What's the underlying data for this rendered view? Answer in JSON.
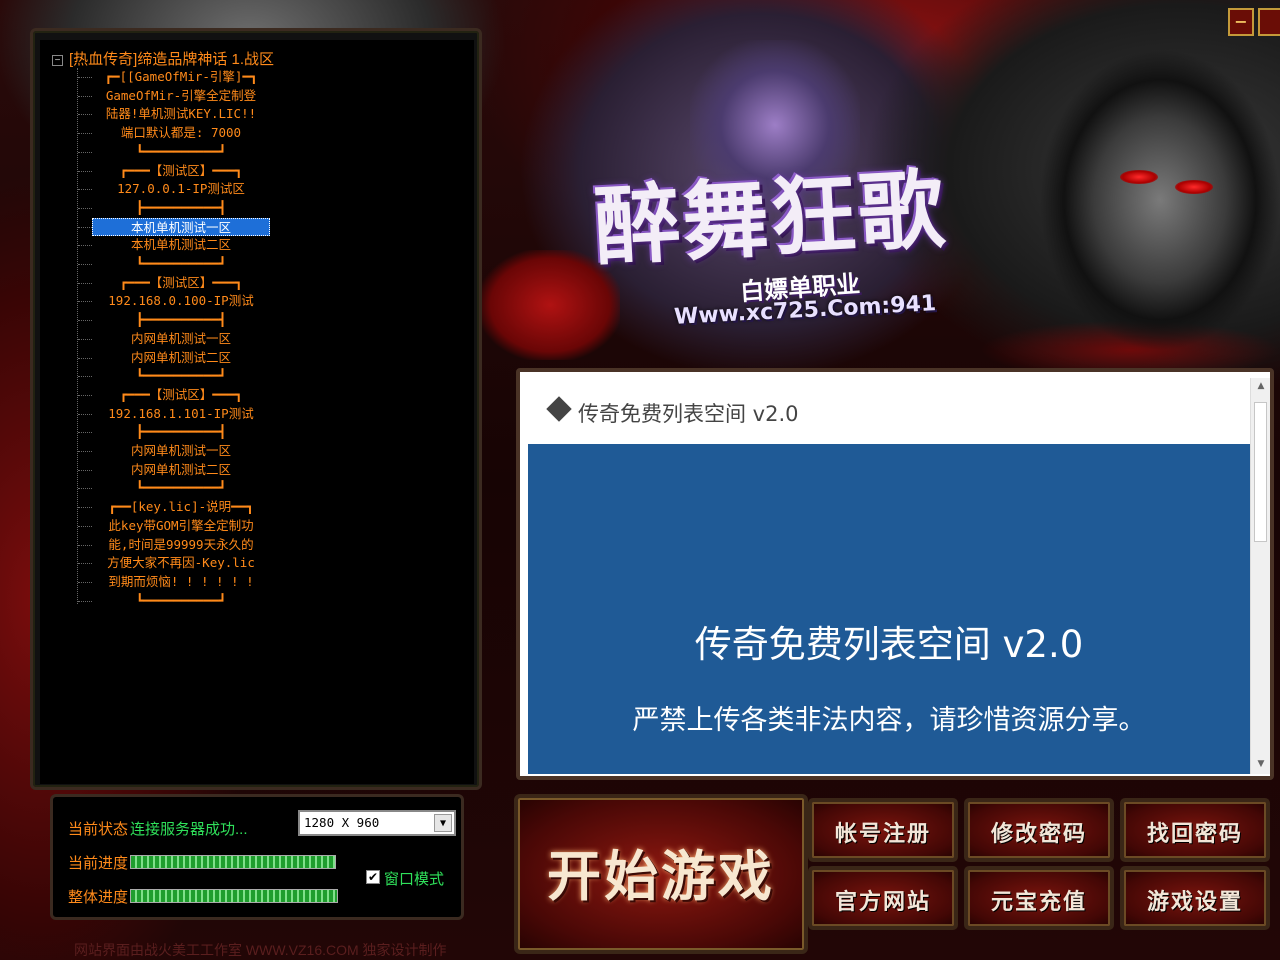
{
  "window": {
    "minimize_label": "−"
  },
  "logo": {
    "title": "醉舞狂歌",
    "subtitle": "白嫖单职业",
    "url": "Www.xc725.Com:941"
  },
  "tree": {
    "root_label": "[热血传奇]缔造品牌神话 1.战区",
    "items": [
      {
        "label": "┏━[[GameOfMir-引擎]━┓"
      },
      {
        "label": "GameOfMir-引擎全定制登"
      },
      {
        "label": "陆器!单机测试KEY.LIC!!"
      },
      {
        "label": "端口默认都是: 7000"
      },
      {
        "label": "┗━━━━━━━━━━┛"
      },
      {
        "label": "┏━━━【测试区】━━━┓"
      },
      {
        "label": "127.0.0.1-IP测试区"
      },
      {
        "label": "┣━━━━━━━━━━┫"
      },
      {
        "label": "本机单机测试一区"
      },
      {
        "label": "本机单机测试二区"
      },
      {
        "label": "┗━━━━━━━━━━┛"
      },
      {
        "label": "┏━━━【测试区】━━━┓"
      },
      {
        "label": "192.168.0.100-IP测试"
      },
      {
        "label": "┣━━━━━━━━━━┫"
      },
      {
        "label": "内网单机测试一区"
      },
      {
        "label": "内网单机测试二区"
      },
      {
        "label": "┗━━━━━━━━━━┛"
      },
      {
        "label": "┏━━━【测试区】━━━┓"
      },
      {
        "label": "192.168.1.101-IP测试"
      },
      {
        "label": "┣━━━━━━━━━━┫"
      },
      {
        "label": "内网单机测试一区"
      },
      {
        "label": "内网单机测试二区"
      },
      {
        "label": "┗━━━━━━━━━━┛"
      },
      {
        "label": "┏━━[key.lic]-说明━━┓"
      },
      {
        "label": "此key带GOM引擎全定制功"
      },
      {
        "label": "能,时间是99999天永久的"
      },
      {
        "label": "方便大家不再因-Key.lic"
      },
      {
        "label": "到期而烦恼! ! ! ! ! !"
      },
      {
        "label": "┗━━━━━━━━━━┛"
      }
    ],
    "selected_index": 8
  },
  "status": {
    "state_label": "当前状态",
    "state_value": "连接服务器成功...",
    "current_progress_label": "当前进度",
    "total_progress_label": "整体进度",
    "current_progress": 1.0,
    "total_progress": 1.0,
    "resolution": "1280 X 960",
    "window_mode_label": "窗口模式",
    "window_mode_checked": true
  },
  "browser": {
    "header_title": "传奇免费列表空间 v2.0",
    "heading": "传奇免费列表空间 v2.0",
    "notice": "严禁上传各类非法内容，请珍惜资源分享。"
  },
  "buttons": {
    "start": "开始游戏",
    "register": "帐号注册",
    "change_password": "修改密码",
    "recover_password": "找回密码",
    "website": "官方网站",
    "recharge": "元宝充值",
    "settings": "游戏设置"
  },
  "footer": "网站界面由战火美工工作室 WWW.VZ16.COM 独家设计制作"
}
